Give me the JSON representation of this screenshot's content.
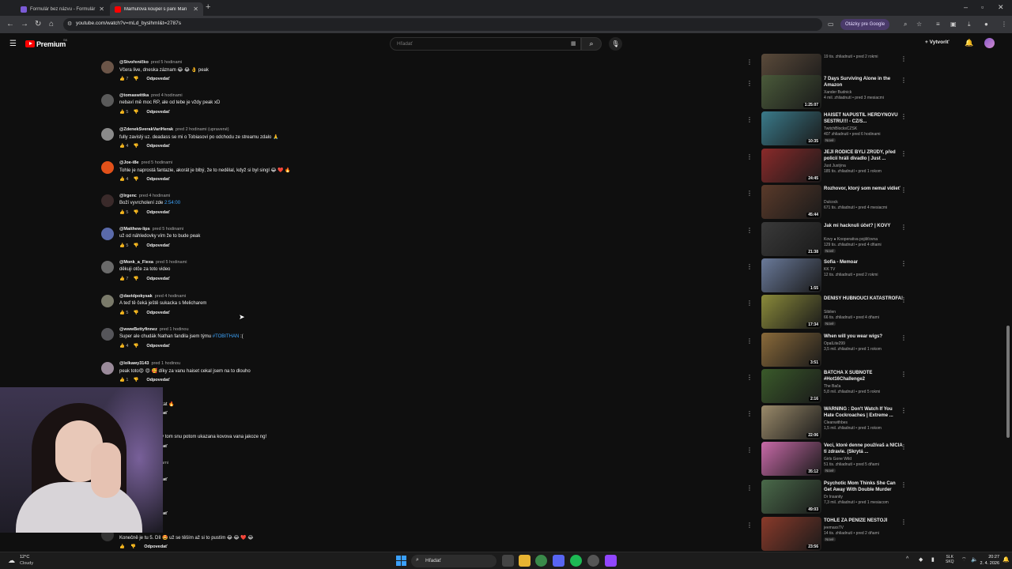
{
  "browser": {
    "tabs": [
      {
        "title": "Formulár bez názvu - Formulár",
        "favicon_color": "#7b5bd6",
        "active": false
      },
      {
        "title": "Marhuľová koupel s paní Mari",
        "favicon_color": "#ff0000",
        "active": true
      }
    ],
    "url": "youtube.com/watch?v=mLd_byslhmI&t=2787s",
    "google_questions": "Otázky pre Google"
  },
  "youtube": {
    "brand": "Premium",
    "brand_sup": "SK",
    "search_placeholder": "Hľadať",
    "create_label": "Vytvoriť"
  },
  "comments": {
    "reply_label": "Odpovedať",
    "items": [
      {
        "user": "@Stvořeníčko",
        "time": "pred 5 hodinami",
        "text": "Včera live, dneska záznam 😂 😂 👌 peak",
        "likes": "7",
        "avatar_color": "#6b5548"
      },
      {
        "user": "@tomaswittka",
        "time": "pred 4 hodinami",
        "text": "nebaví mě moc RP, ale od tebe je vždy peak xD",
        "likes": "5",
        "avatar_color": "#5a5a5a"
      },
      {
        "user": "@ZdenekSverakVariHerak",
        "time": "pred 2 hodinami (upravené)",
        "text": "fully zavislý uz. deadass se mi o Tobiasovi po odchodu ze streamu zdalo 🙏",
        "likes": "4",
        "avatar_color": "#8a8a8a"
      },
      {
        "user": "@Joe-t8e",
        "time": "pred 5 hodinami",
        "text": "Tohle je naprostá fantazie, akorát je blbý, že to nedělal, když si byl singl 😂 ❤️ 🔥",
        "likes": "4",
        "avatar_color": "#e2511a"
      },
      {
        "user": "@lrgenc",
        "time": "pred 4 hodinami",
        "text": "Boží vyvrcholení zde ",
        "link": "2:54:00",
        "likes": "5",
        "avatar_color": "#3a2a2a"
      },
      {
        "user": "@Matthew-lips",
        "time": "pred 5 hodinami",
        "text": "už od náhledovky vím že to bude peak",
        "likes": "5",
        "avatar_color": "#5a6aaa"
      },
      {
        "user": "@Monk_a_Fiexa",
        "time": "pred 5 hodinami",
        "text": "děkuji otče za toto video",
        "likes": "7",
        "avatar_color": "#6a6a6a"
      },
      {
        "user": "@davidpokysak",
        "time": "pred 4 hodinami",
        "text": "A teď tě čeká ještě sukacka s Melicharem",
        "likes": "5",
        "avatar_color": "#7a7a6a"
      },
      {
        "user": "@wwwBettyfinnez",
        "time": "pred 1 hodinou",
        "text": "Super ale chudák Nathan fandila jsem týmu ",
        "link": "#TOBITHAN",
        "tail": " :(",
        "likes": "4",
        "avatar_color": "#55555a"
      },
      {
        "user": "@lolkawy3143",
        "time": "pred 1 hodinou",
        "text": "peak toto😍 😍 🥰 díky za vanu haiset cekal jsem na to dlouho",
        "likes": "1",
        "avatar_color": "#9a8a9a"
      },
      {
        "user": "",
        "time": "pred 5 hodinami",
        "text": "y, no nic, jde se koukat 🔥",
        "likes": "",
        "avatar_color": "#333"
      },
      {
        "user": "",
        "time": "ami",
        "text": "mi to zdalo ale bylo v tom snu potom ukazana kovova vana jakoze ng!",
        "likes": "",
        "avatar_color": "#333"
      },
      {
        "user": "erodice",
        "time": "pred 5 hodinami",
        "text": "",
        "likes": "",
        "avatar_color": "#333"
      },
      {
        "user": "",
        "time": "ami",
        "text": "😂",
        "likes": "",
        "avatar_color": "#333"
      },
      {
        "user": "",
        "time": "ami",
        "text": "Konečně je tu 5. Díl 🤩 už se těším až si to pustím 😂 😂 ❤️ 😂",
        "likes": "",
        "avatar_color": "#333"
      }
    ]
  },
  "related": [
    {
      "title": "",
      "channel": "",
      "meta": "19 tis. zhliadnutí • pred 2 rokmi",
      "duration": "1:42",
      "badge": "",
      "thumb": "#5a4a3a"
    },
    {
      "title": "7 Days Surviving Alone in the Amazon",
      "channel": "Xander Budnick",
      "meta": "4 mil. zhliadnutí • pred 3 mesiacmi",
      "duration": "1:25:07",
      "badge": "",
      "thumb": "#4a5a3a"
    },
    {
      "title": "HAISET NAPUSTIL HERDYNOVU SESTRU!!! - CZ/S...",
      "channel": "TwitchBlocksCZSK",
      "meta": "407 zhliadnutí • pred 6 hodinami",
      "duration": "10:35",
      "badge": "Nové",
      "thumb": "#3a7a8a"
    },
    {
      "title": "JEJÍ RODIČE BYLI ZRŮDY, před policií hráli divadlo | Just ...",
      "channel": "Just Justýna",
      "meta": "185 tis. zhliadnutí • pred 1 rokom",
      "duration": "24:45",
      "badge": "",
      "thumb": "#8a2a2a"
    },
    {
      "title": "Rozhovor, ktorý som nemal vidieť",
      "channel": "Dulcock",
      "meta": "671 tis. zhliadnutí • pred 4 mesiacmi",
      "duration": "45:44",
      "badge": "",
      "thumb": "#5a3a2a"
    },
    {
      "title": "Jak mi hacknuli účet? | KOVY",
      "channel": "Kovy ● Kooperativa pojišťovna",
      "meta": "129 tis. zhliadnutí • pred 4 dňami",
      "duration": "21:38",
      "badge": "Nové",
      "thumb": "#3a3a3a"
    },
    {
      "title": "Sofia - Memoar",
      "channel": "KK TV",
      "meta": "12 tis. zhliadnutí • pred 2 rokmi",
      "duration": "1:55",
      "badge": "",
      "thumb": "#6a7a9a"
    },
    {
      "title": "DENISY HUBNOUCÍ KATASTROFA!",
      "channel": "Sibilen",
      "meta": "66 tis. zhliadnutí • pred 4 dňami",
      "duration": "17:34",
      "badge": "Nové",
      "thumb": "#8a8a3a"
    },
    {
      "title": "When will you wear wigs?",
      "channel": "OpalLite299",
      "meta": "3,5 mil. zhliadnutí • pred 1 rokom",
      "duration": "3:51",
      "badge": "",
      "thumb": "#8a6a3a"
    },
    {
      "title": "BATCHA X SUBNOTE #Hot16Challenge2",
      "channel": "The Bača",
      "meta": "5,8 mil. zhliadnutí • pred 5 rokmi",
      "duration": "2:16",
      "badge": "",
      "thumb": "#3a5a2a"
    },
    {
      "title": "WARNING : Don't Watch If You Hate Cockroaches | Extreme ...",
      "channel": "Cleanwithbes",
      "meta": "1,5 mil. zhliadnutí • pred 1 rokom",
      "duration": "22:06",
      "badge": "",
      "thumb": "#9a8a6a"
    },
    {
      "title": "Veci, ktoré denne používaš a NIČIA ti zdravie. (Skrytá ...",
      "channel": "Girls Gone Wild",
      "meta": "51 tis. zhliadnutí • pred 5 dňami",
      "duration": "35:12",
      "badge": "Nové",
      "thumb": "#c86aa8"
    },
    {
      "title": "Psychotic Mom Thinks She Can Get Away With Double Murder",
      "channel": "Dr Insanity",
      "meta": "7,3 mil. zhliadnutí • pred 1 mesiacom",
      "duration": "49:03",
      "badge": "",
      "thumb": "#4a6a4a"
    },
    {
      "title": "TOHLE ZA PENÍZE NESTOJÍ",
      "channel": "jeemaxsTV",
      "meta": "14 tis. zhliadnutí • pred 2 dňami",
      "duration": "23:56",
      "badge": "Nové",
      "thumb": "#8a3a2a"
    }
  ],
  "taskbar": {
    "temp": "12°C",
    "weather": "Cloudy",
    "search_label": "Hľadať",
    "lang_top": "SLK",
    "lang_bottom": "SKQ",
    "time": "20:27",
    "date": "2. 4. 2026"
  }
}
